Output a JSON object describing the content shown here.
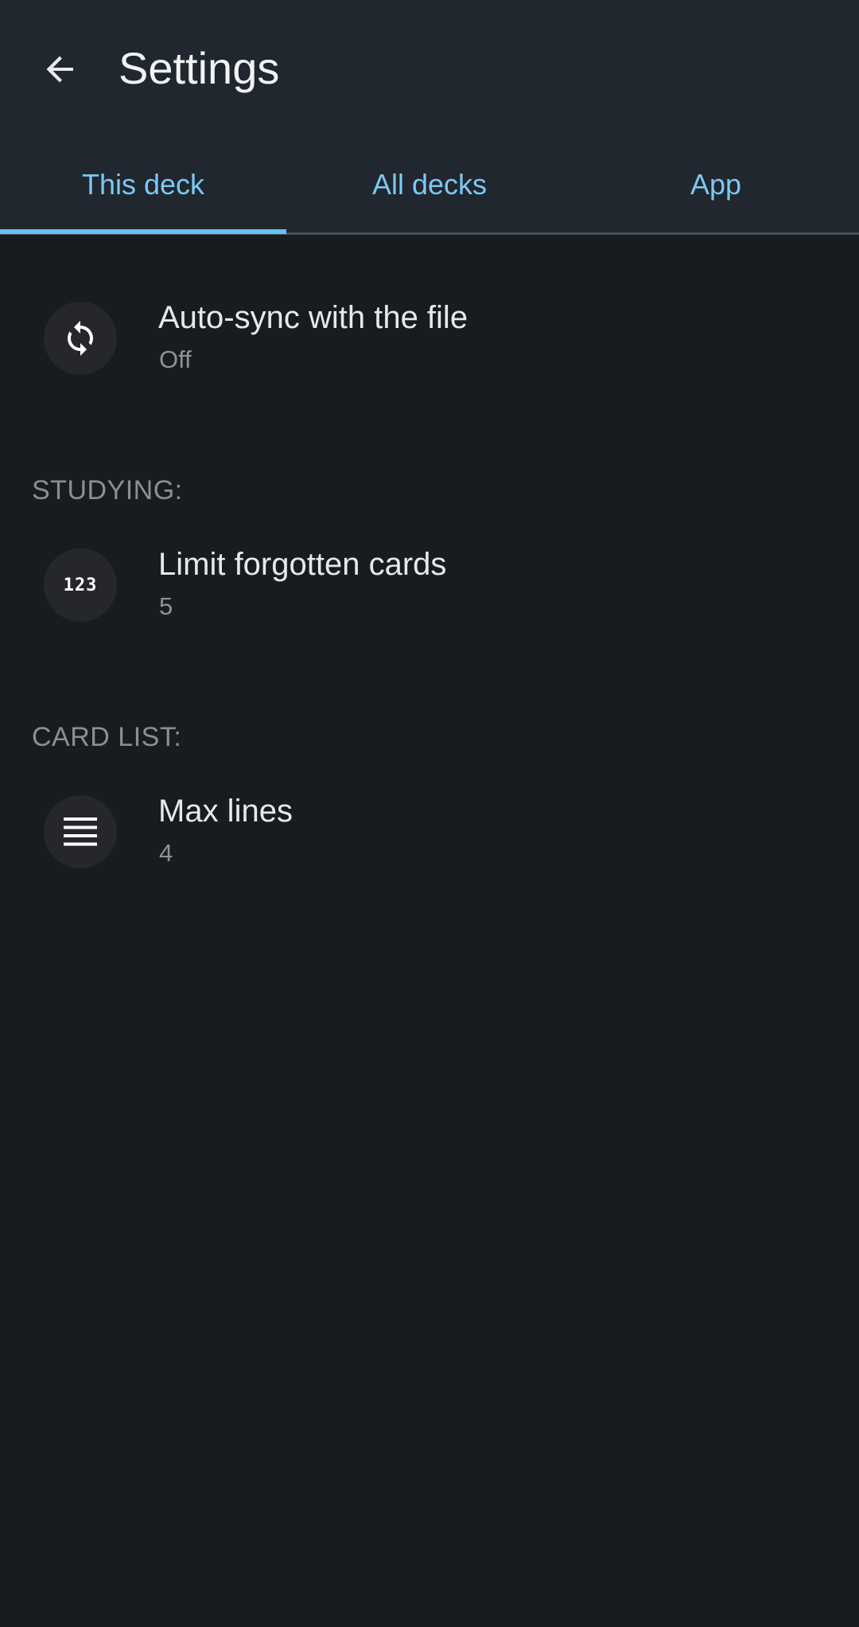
{
  "header": {
    "title": "Settings",
    "back_icon": "arrow-back-icon"
  },
  "tabs": [
    {
      "label": "This deck",
      "selected": true
    },
    {
      "label": "All decks",
      "selected": false
    },
    {
      "label": "App",
      "selected": false
    }
  ],
  "prefs": {
    "autosync": {
      "title": "Auto-sync with the file",
      "summary": "Off",
      "icon": "sync-icon"
    },
    "studying_header": "STUDYING:",
    "limit_forgotten": {
      "title": "Limit forgotten cards",
      "summary": "5",
      "icon": "numeric-123-icon",
      "icon_text": "123"
    },
    "cardlist_header": "CARD LIST:",
    "max_lines": {
      "title": "Max lines",
      "summary": "4",
      "icon": "lines-icon"
    }
  },
  "colors": {
    "background": "#191c1f",
    "appbar": "#20272e",
    "accent": "#63c3f5",
    "tab_text": "#7cc8f2",
    "icon_circle": "#25272a"
  }
}
